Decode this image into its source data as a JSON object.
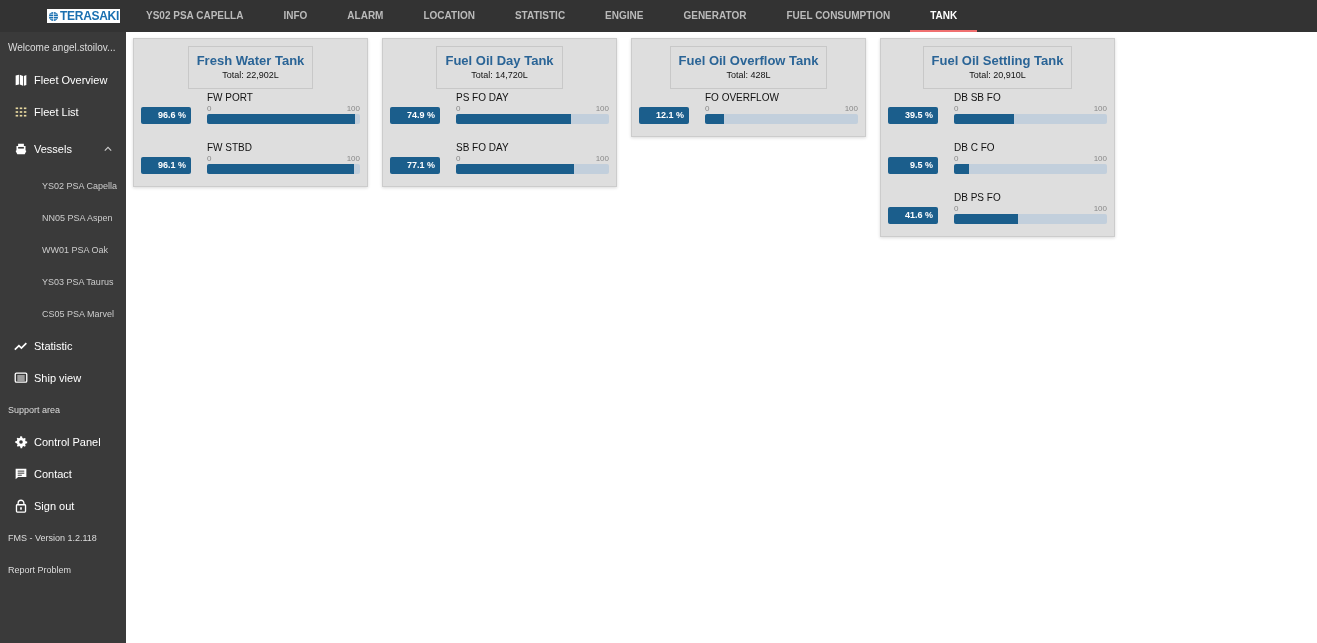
{
  "logo": {
    "text": "TERASAKI"
  },
  "tabs": [
    {
      "label": "YS02 PSA CAPELLA",
      "selected": false
    },
    {
      "label": "INFO",
      "selected": false
    },
    {
      "label": "ALARM",
      "selected": false
    },
    {
      "label": "LOCATION",
      "selected": false
    },
    {
      "label": "STATISTIC",
      "selected": false
    },
    {
      "label": "ENGINE",
      "selected": false
    },
    {
      "label": "GENERATOR",
      "selected": false
    },
    {
      "label": "FUEL CONSUMPTION",
      "selected": false
    },
    {
      "label": "TANK",
      "selected": true
    }
  ],
  "sidebar": {
    "welcome": "Welcome angel.stoilov...",
    "items": [
      {
        "kind": "nav",
        "label": "Fleet Overview"
      },
      {
        "kind": "nav",
        "label": "Fleet List"
      },
      {
        "kind": "group",
        "label": "Vessels",
        "expanded": true,
        "children": [
          {
            "label": "YS02 PSA Capella"
          },
          {
            "label": "NN05 PSA Aspen"
          },
          {
            "label": "WW01 PSA Oak"
          },
          {
            "label": "YS03 PSA Taurus"
          },
          {
            "label": "CS05 PSA Marvel"
          }
        ]
      },
      {
        "kind": "nav",
        "label": "Statistic"
      },
      {
        "kind": "nav",
        "label": "Ship view"
      },
      {
        "kind": "section",
        "label": "Support area"
      },
      {
        "kind": "nav",
        "label": "Control Panel"
      },
      {
        "kind": "nav",
        "label": "Contact"
      },
      {
        "kind": "nav",
        "label": "Sign out"
      },
      {
        "kind": "section",
        "label": "FMS - Version 1.2.118"
      },
      {
        "kind": "section",
        "label": "Report Problem"
      }
    ]
  },
  "tanks": [
    {
      "title": "Fresh Water Tank",
      "total": "Total: 22,902L",
      "gauges": [
        {
          "name": "FW PORT",
          "reading": "96.6 %",
          "min": "0",
          "max": "100",
          "level": 0.966
        },
        {
          "name": "FW STBD",
          "reading": "96.1 %",
          "min": "0",
          "max": "100",
          "level": 0.961
        }
      ]
    },
    {
      "title": "Fuel Oil Day Tank",
      "total": "Total: 14,720L",
      "gauges": [
        {
          "name": "PS FO DAY",
          "reading": "74.9 %",
          "min": "0",
          "max": "100",
          "level": 0.749
        },
        {
          "name": "SB FO DAY",
          "reading": "77.1 %",
          "min": "0",
          "max": "100",
          "level": 0.771
        }
      ]
    },
    {
      "title": "Fuel Oil Overflow Tank",
      "total": "Total: 428L",
      "gauges": [
        {
          "name": "FO OVERFLOW",
          "reading": "12.1 %",
          "min": "0",
          "max": "100",
          "level": 0.121
        }
      ]
    },
    {
      "title": "Fuel Oil Settling Tank",
      "total": "Total: 20,910L",
      "gauges": [
        {
          "name": "DB SB FO",
          "reading": "39.5 %",
          "min": "0",
          "max": "100",
          "level": 0.395
        },
        {
          "name": "DB C FO",
          "reading": "9.5 %",
          "min": "0",
          "max": "100",
          "level": 0.095
        },
        {
          "name": "DB PS FO",
          "reading": "41.6 %",
          "min": "0",
          "max": "100",
          "level": 0.416
        }
      ]
    }
  ]
}
